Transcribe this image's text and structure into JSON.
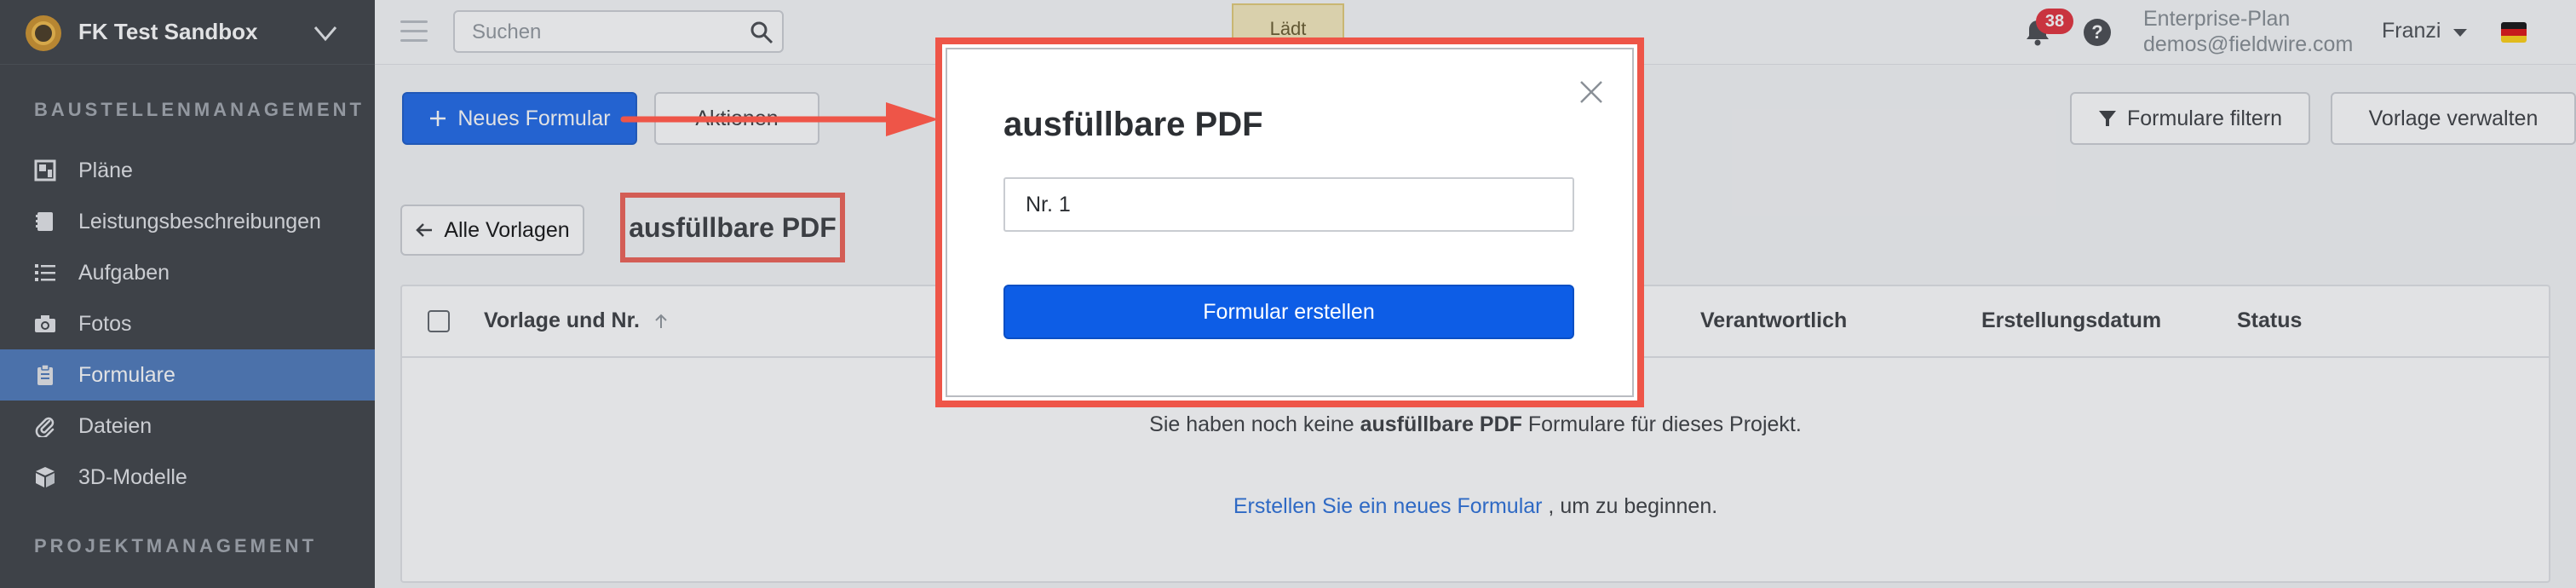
{
  "project": {
    "name": "FK Test Sandbox"
  },
  "sidebar": {
    "section1": "BAUSTELLENMANAGEMENT",
    "section2": "PROJEKTMANAGEMENT",
    "items": [
      {
        "label": "Pläne",
        "icon": "plans-icon"
      },
      {
        "label": "Leistungsbeschreibungen",
        "icon": "specs-icon"
      },
      {
        "label": "Aufgaben",
        "icon": "tasks-icon"
      },
      {
        "label": "Fotos",
        "icon": "camera-icon"
      },
      {
        "label": "Formulare",
        "icon": "clipboard-icon",
        "active": true
      },
      {
        "label": "Dateien",
        "icon": "paperclip-icon"
      },
      {
        "label": "3D-Modelle",
        "icon": "cube-icon"
      }
    ]
  },
  "topbar": {
    "search_placeholder": "Suchen",
    "loading": "Lädt",
    "notification_count": "38",
    "plan": "Enterprise-Plan",
    "email": "demos@fieldwire.com",
    "user": "Franzi"
  },
  "toolbar": {
    "new_form": "Neues Formular",
    "actions": "Aktionen",
    "filter": "Formulare filtern",
    "manage_template": "Vorlage verwalten"
  },
  "breadcrumb": {
    "back": "Alle Vorlagen",
    "current": "ausfüllbare PDF"
  },
  "table": {
    "columns": [
      "Vorlage und Nr.",
      "Verantwortlich",
      "Erstellungsdatum",
      "Status"
    ],
    "empty_prefix": "Sie haben noch keine ",
    "empty_bold": "ausfüllbare PDF",
    "empty_suffix": " Formulare für dieses Projekt.",
    "cta_link": "Erstellen Sie ein neues Formular",
    "cta_suffix": " , um zu beginnen."
  },
  "modal": {
    "title": "ausfüllbare PDF",
    "input_value": "Nr. 1",
    "submit": "Formular erstellen"
  },
  "colors": {
    "primary": "#0d5de6",
    "sidebar_bg": "#2f3338",
    "sidebar_active": "#3f6fb5",
    "highlight": "#ee5548",
    "badge": "#e0202c"
  }
}
